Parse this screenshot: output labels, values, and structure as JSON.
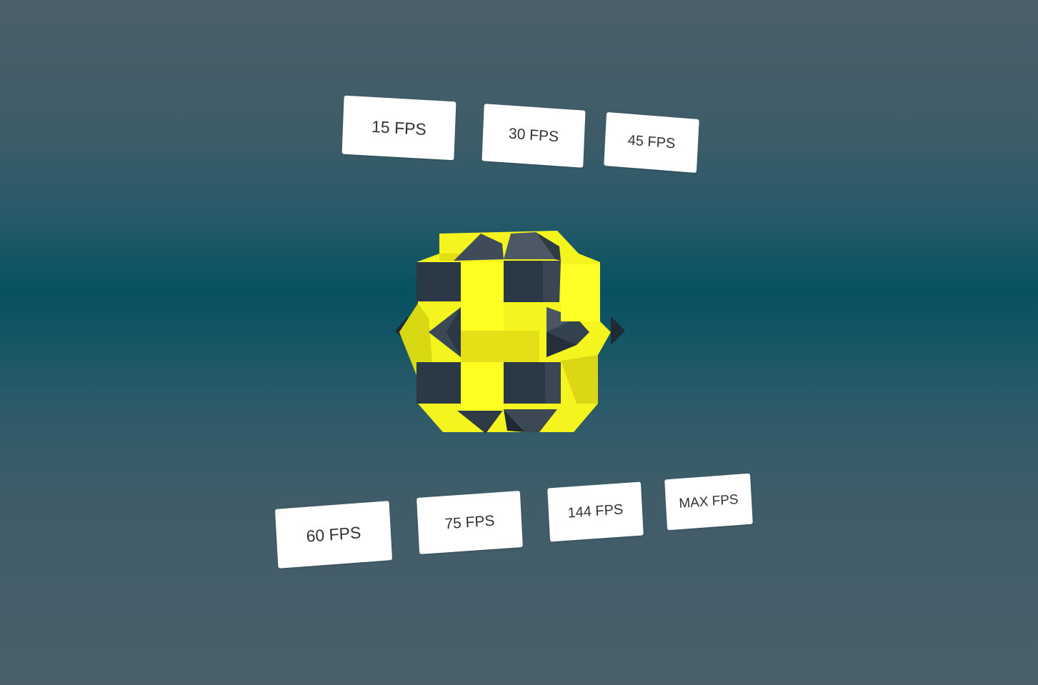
{
  "top_row": [
    {
      "label": "15 FPS"
    },
    {
      "label": "30 FPS"
    },
    {
      "label": "45 FPS"
    }
  ],
  "bottom_row": [
    {
      "label": "60 FPS"
    },
    {
      "label": "75 FPS"
    },
    {
      "label": "144 FPS"
    },
    {
      "label": "MAX FPS"
    }
  ],
  "colors": {
    "background_center": "#07525f",
    "background_edge": "#4b6069",
    "polyhedron_yellow": "#ffff22",
    "polyhedron_dark": "#2d3a48",
    "button_bg": "#ffffff",
    "button_text": "#333333"
  }
}
